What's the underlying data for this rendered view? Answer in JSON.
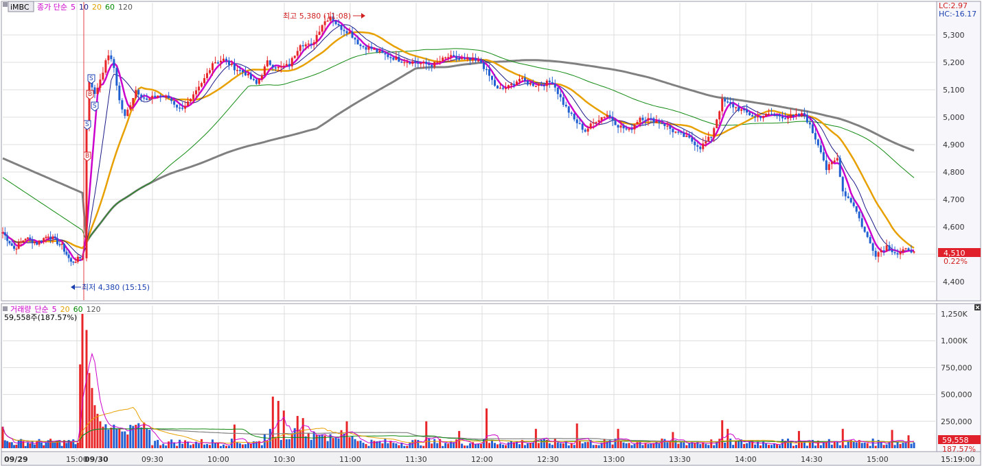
{
  "price_header": {
    "symbol": "iMBC",
    "items": [
      {
        "text": "종가 단순",
        "color": "#cc00cc"
      },
      {
        "text": "5",
        "color": "#cc00cc"
      },
      {
        "text": "10",
        "color": "#1a1a88"
      },
      {
        "text": "20",
        "color": "#e0a000"
      },
      {
        "text": "60",
        "color": "#008800"
      },
      {
        "text": "120",
        "color": "#555555"
      }
    ]
  },
  "volume_header": {
    "items": [
      {
        "text": "거래량",
        "color": "#cc00cc"
      },
      {
        "text": "단순",
        "color": "#cc00cc"
      },
      {
        "text": "5",
        "color": "#cc00cc"
      },
      {
        "text": "20",
        "color": "#e0a000"
      },
      {
        "text": "60",
        "color": "#008800"
      },
      {
        "text": "120",
        "color": "#555555"
      }
    ],
    "current": "59,558주(187.57%)"
  },
  "corner": {
    "lc": "LC:2.97",
    "hc": "HC:-16.17"
  },
  "annotations": {
    "high": "최고 5,380 (11:08)",
    "low": "최저 4,380 (15:15)"
  },
  "current_price": {
    "price": "4,510",
    "change": "0.22%",
    "volume": "59,558",
    "vol_pct": "187.57%"
  },
  "time_readout": "15:19:00",
  "colors": {
    "up": "#e8262a",
    "down": "#1f5fd1",
    "ma5": "#cc00cc",
    "ma10": "#1a1a88",
    "ma20": "#e8a000",
    "ma60": "#108a10",
    "ma120": "#808080"
  },
  "signals": [
    "S",
    "B",
    "S",
    "S",
    "B"
  ],
  "chart_data": [
    {
      "type": "candlestick",
      "title": "",
      "y_ticks": [
        5300,
        5200,
        5100,
        5000,
        4900,
        4800,
        4700,
        4600,
        4500,
        4400
      ],
      "y_tick_labels": [
        "5,300",
        "5,200",
        "5,100",
        "5,000",
        "4,900",
        "4,800",
        "4,700",
        "4,600",
        "4,500",
        "4,400"
      ],
      "ylim": [
        4330,
        5420
      ],
      "x_labels": [
        {
          "day": 1,
          "t": 0,
          "label": "09/29"
        },
        {
          "day": 1,
          "t": 30,
          "label": "15:00"
        },
        {
          "day": 2,
          "t": 0,
          "label": "09/30"
        },
        {
          "day": 2,
          "t": 30,
          "label": "09:30"
        },
        {
          "day": 2,
          "t": 60,
          "label": "10:00"
        },
        {
          "day": 2,
          "t": 90,
          "label": "10:30"
        },
        {
          "day": 2,
          "t": 120,
          "label": "11:00"
        },
        {
          "day": 2,
          "t": 150,
          "label": "11:30"
        },
        {
          "day": 2,
          "t": 180,
          "label": "12:00"
        },
        {
          "day": 2,
          "t": 210,
          "label": "12:30"
        },
        {
          "day": 2,
          "t": 240,
          "label": "13:00"
        },
        {
          "day": 2,
          "t": 270,
          "label": "13:30"
        },
        {
          "day": 2,
          "t": 300,
          "label": "14:00"
        },
        {
          "day": 2,
          "t": 330,
          "label": "14:30"
        },
        {
          "day": 2,
          "t": 360,
          "label": "15:00"
        }
      ],
      "anchors": [
        [
          0,
          4580
        ],
        [
          5,
          4520
        ],
        [
          10,
          4560
        ],
        [
          15,
          4540
        ],
        [
          20,
          4570
        ],
        [
          26,
          4530
        ],
        [
          30,
          4470
        ],
        [
          35,
          4490
        ],
        [
          36,
          4960
        ],
        [
          37,
          5150
        ],
        [
          39,
          5080
        ],
        [
          42,
          5170
        ],
        [
          44,
          5230
        ],
        [
          46,
          5180
        ],
        [
          48,
          5060
        ],
        [
          50,
          5000
        ],
        [
          54,
          5100
        ],
        [
          58,
          5060
        ],
        [
          62,
          5080
        ],
        [
          66,
          5070
        ],
        [
          70,
          5030
        ],
        [
          74,
          5060
        ],
        [
          78,
          5120
        ],
        [
          82,
          5200
        ],
        [
          86,
          5210
        ],
        [
          90,
          5180
        ],
        [
          94,
          5160
        ],
        [
          98,
          5120
        ],
        [
          102,
          5200
        ],
        [
          106,
          5180
        ],
        [
          110,
          5190
        ],
        [
          114,
          5270
        ],
        [
          118,
          5260
        ],
        [
          122,
          5340
        ],
        [
          125,
          5370
        ],
        [
          128,
          5330
        ],
        [
          132,
          5310
        ],
        [
          136,
          5260
        ],
        [
          140,
          5250
        ],
        [
          144,
          5230
        ],
        [
          150,
          5210
        ],
        [
          156,
          5200
        ],
        [
          162,
          5190
        ],
        [
          168,
          5220
        ],
        [
          174,
          5210
        ],
        [
          180,
          5200
        ],
        [
          186,
          5100
        ],
        [
          190,
          5110
        ],
        [
          194,
          5140
        ],
        [
          198,
          5120
        ],
        [
          202,
          5120
        ],
        [
          206,
          5130
        ],
        [
          210,
          5050
        ],
        [
          214,
          4990
        ],
        [
          218,
          4950
        ],
        [
          222,
          4990
        ],
        [
          226,
          5010
        ],
        [
          230,
          4970
        ],
        [
          234,
          4950
        ],
        [
          238,
          5000
        ],
        [
          242,
          4990
        ],
        [
          246,
          4980
        ],
        [
          250,
          4950
        ],
        [
          256,
          4920
        ],
        [
          260,
          4890
        ],
        [
          264,
          4930
        ],
        [
          268,
          5060
        ],
        [
          272,
          5040
        ],
        [
          276,
          5020
        ],
        [
          280,
          5000
        ],
        [
          286,
          5010
        ],
        [
          292,
          5000
        ],
        [
          298,
          5010
        ],
        [
          304,
          4880
        ],
        [
          306,
          4810
        ],
        [
          310,
          4850
        ],
        [
          312,
          4730
        ],
        [
          316,
          4680
        ],
        [
          320,
          4580
        ],
        [
          324,
          4500
        ],
        [
          328,
          4530
        ],
        [
          332,
          4500
        ],
        [
          336,
          4520
        ],
        [
          338,
          4510
        ]
      ],
      "high": 5380,
      "low": 4380,
      "last": 4510
    },
    {
      "type": "bar",
      "title": "거래량",
      "y_ticks": [
        1250000,
        1000000,
        750000,
        500000,
        250000
      ],
      "y_tick_labels": [
        "1,250K",
        "1,000K",
        "750,000",
        "500,000",
        "250,000"
      ],
      "ylim": [
        0,
        1300000
      ],
      "spikes": [
        [
          0,
          200000
        ],
        [
          34,
          780000
        ],
        [
          35,
          1250000
        ],
        [
          36,
          1100000
        ],
        [
          37,
          700000
        ],
        [
          38,
          560000
        ],
        [
          39,
          400000
        ],
        [
          40,
          320000
        ],
        [
          41,
          250000
        ],
        [
          42,
          200000
        ],
        [
          90,
          220000
        ],
        [
          104,
          480000
        ],
        [
          106,
          440000
        ],
        [
          108,
          350000
        ],
        [
          113,
          300000
        ],
        [
          115,
          280000
        ],
        [
          131,
          250000
        ],
        [
          160,
          250000
        ],
        [
          172,
          160000
        ],
        [
          182,
          370000
        ],
        [
          200,
          180000
        ],
        [
          215,
          230000
        ],
        [
          230,
          180000
        ],
        [
          250,
          150000
        ],
        [
          268,
          260000
        ],
        [
          270,
          180000
        ],
        [
          296,
          160000
        ],
        [
          312,
          180000
        ],
        [
          330,
          170000
        ],
        [
          336,
          120000
        ]
      ],
      "last": 59558
    }
  ]
}
